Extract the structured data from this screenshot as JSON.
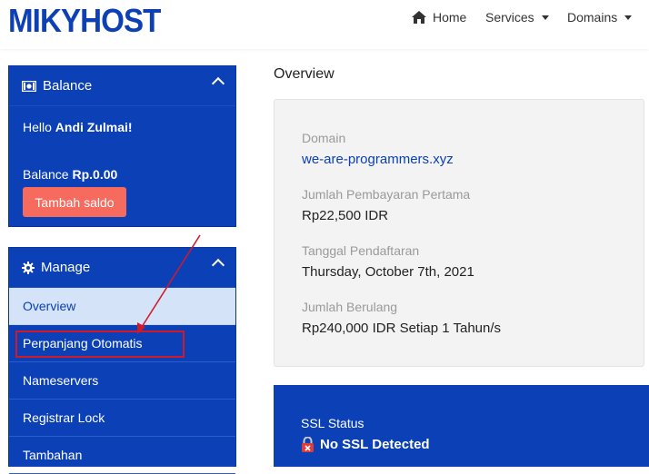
{
  "header": {
    "logo": "MIKYHOST",
    "nav": [
      {
        "label": "Home"
      },
      {
        "label": "Services"
      },
      {
        "label": "Domains"
      }
    ]
  },
  "sidebar": {
    "balance": {
      "title": "Balance",
      "hello_prefix": "Hello ",
      "user_name": "Andi Zulmai!",
      "balance_prefix": "Balance ",
      "balance_value": "Rp.0.00",
      "topup_button": "Tambah saldo"
    },
    "manage": {
      "title": "Manage",
      "items": [
        {
          "label": "Overview"
        },
        {
          "label": "Perpanjang Otomatis"
        },
        {
          "label": "Nameservers"
        },
        {
          "label": "Registrar Lock"
        },
        {
          "label": "Tambahan"
        }
      ]
    }
  },
  "main": {
    "title": "Overview",
    "info": {
      "domain_label": "Domain",
      "domain_value": "we-are-programmers.xyz",
      "first_payment_label": "Jumlah Pembayaran Pertama",
      "first_payment_value": "Rp22,500 IDR",
      "reg_date_label": "Tanggal Pendaftaran",
      "reg_date_value": "Thursday, October 7th, 2021",
      "recurring_label": "Jumlah Berulang",
      "recurring_value": "Rp240,000 IDR Setiap 1 Tahun/s"
    },
    "ssl": {
      "label": "SSL Status",
      "value": "No SSL Detected"
    }
  },
  "colors": {
    "brand_blue": "#0c40b6",
    "button_coral": "#f76a5e",
    "annotation_red": "#d01a2a"
  }
}
